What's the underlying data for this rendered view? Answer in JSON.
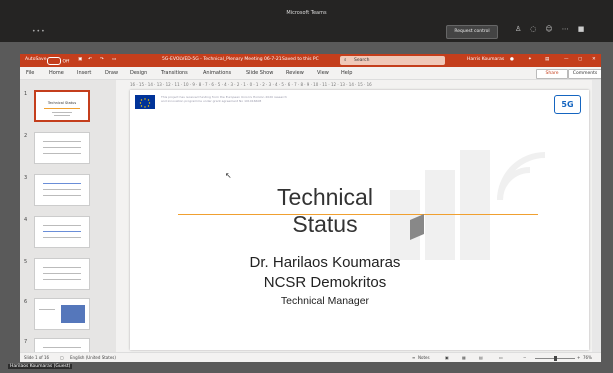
{
  "teams": {
    "window_title": "Microsoft Teams",
    "request_control_label": "Request control",
    "more_label": "•••"
  },
  "ppt": {
    "autosave_label": "AutoSave",
    "autosave_state": "Off",
    "file_title": "5G-EVOLVED-5G - Technical_Plenary Meeting 06-7-21",
    "saved_state": "Saved to this PC",
    "search_placeholder": "Search",
    "user_name": "Harris Koumaras",
    "menu": [
      "File",
      "Home",
      "Insert",
      "Draw",
      "Design",
      "Transitions",
      "Animations",
      "Slide Show",
      "Review",
      "View",
      "Help"
    ],
    "share_label": "Share",
    "comments_label": "Comments",
    "ruler_text": "16 · 15 · 14 · 13 · 12 · 11 · 10 · 9 · 8 · 7 · 6 · 5 · 4 · 3 · 2 · 1 · 0 · 1 · 2 · 3 · 4 · 5 · 6 · 7 · 8 · 9 · 10 · 11 · 12 · 13 · 14 · 15 · 16",
    "thumbnails": [
      {
        "num": "1",
        "title": "Technical Status"
      },
      {
        "num": "2",
        "title": ""
      },
      {
        "num": "3",
        "title": ""
      },
      {
        "num": "4",
        "title": ""
      },
      {
        "num": "5",
        "title": ""
      },
      {
        "num": "6",
        "title": ""
      },
      {
        "num": "7",
        "title": ""
      }
    ],
    "slide": {
      "eu_text": "This project has received funding from the European Union's Horizon 2020 research and innovation programme under grant agreement No 101016608",
      "logo_text": "5G",
      "title": "Technical Status",
      "presenter": "Dr. Harilaos Koumaras",
      "organization": "NCSR Demokritos",
      "role": "Technical Manager"
    },
    "status": {
      "slide_counter": "Slide 1 of 16",
      "language": "English (United States)",
      "notes_label": "Notes",
      "zoom": "76%"
    }
  },
  "caption": "Harilaos Koumaras (Guest)"
}
